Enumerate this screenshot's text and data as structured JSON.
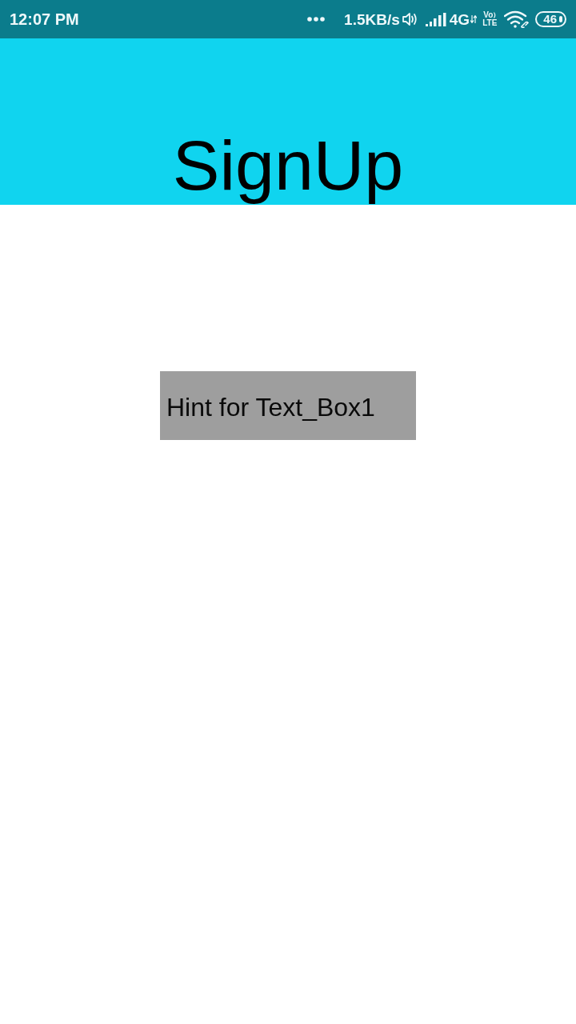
{
  "status_bar": {
    "time": "12:07 PM",
    "network_speed": "1.5KB/s",
    "network_type": "4G",
    "volte_top": "Vo",
    "volte_bottom": "LTE",
    "battery": "46"
  },
  "header": {
    "title": "SignUp"
  },
  "form": {
    "text_box": {
      "placeholder": "Hint for Text_Box1"
    }
  }
}
